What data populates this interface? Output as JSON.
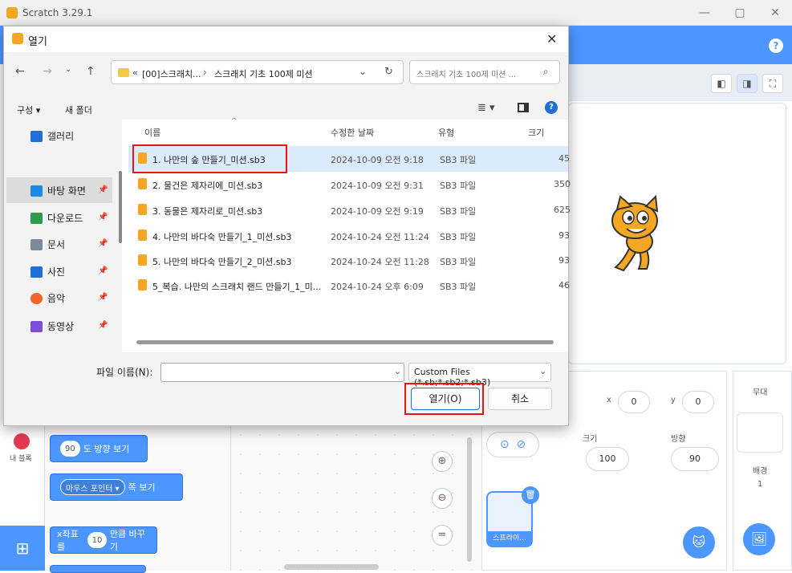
{
  "window": {
    "title": "Scratch 3.29.1",
    "minimize": "—",
    "maximize": "▢",
    "close": "✕"
  },
  "scratch": {
    "help": "?",
    "sprite_info": {
      "x_label": "x",
      "x_value": "0",
      "y_label": "y",
      "y_value": "0",
      "size_label": "크기",
      "size_value": "100",
      "direction_label": "방향",
      "direction_value": "90"
    },
    "sprite_thumb_label": "스프라이...",
    "stage_label": "무대",
    "backdrop_label": "배경",
    "backdrop_count": "1",
    "category": {
      "label": "내 블록"
    },
    "blocks": {
      "point_dir_value": "90",
      "point_dir_text": "도 방향 보기",
      "point_towards_value": "마우스 포인터 ▾",
      "point_towards_text": "쪽 보기",
      "change_x_prefix": "x좌표를",
      "change_x_value": "10",
      "change_x_suffix": "만큼 바꾸기"
    }
  },
  "dialog": {
    "title": "열기",
    "close": "✕",
    "address_parts": [
      "«",
      "[00]스크래치...",
      "›",
      "스크래치 기초 100제 미션"
    ],
    "search_placeholder": "스크래치 기초 100제 미션 ...",
    "commands": {
      "organize": "구성 ▾",
      "new_folder": "새 폴더"
    },
    "nav_items": [
      {
        "label": "갤러리",
        "color": "#1f6fd6"
      },
      {
        "label": "바탕 화면",
        "color": "#1e88e5",
        "pinned": true,
        "selected": true
      },
      {
        "label": "다운로드",
        "color": "#2e9a4a",
        "pinned": true
      },
      {
        "label": "문서",
        "color": "#7d8a99",
        "pinned": true
      },
      {
        "label": "사진",
        "color": "#1f6fd6",
        "pinned": true
      },
      {
        "label": "음악",
        "color": "#f06529",
        "pinned": true
      },
      {
        "label": "동영상",
        "color": "#7b4fd6",
        "pinned": true
      }
    ],
    "pin_glyph": "📌",
    "columns": {
      "name": "이름",
      "modified": "수정한 날짜",
      "type": "유형",
      "size": "크기"
    },
    "files": [
      {
        "name": "1. 나만의 숲 만들기_미션.sb3",
        "modified": "2024-10-09 오전 9:18",
        "type": "SB3 파일",
        "size": "45"
      },
      {
        "name": "2. 물건은 제자리에_미션.sb3",
        "modified": "2024-10-09 오전 9:31",
        "type": "SB3 파일",
        "size": "350"
      },
      {
        "name": "3. 동물은 제자리로_미션.sb3",
        "modified": "2024-10-09 오전 9:19",
        "type": "SB3 파일",
        "size": "625"
      },
      {
        "name": "4. 나만의 바다숙 만들기_1_미션.sb3",
        "modified": "2024-10-24 오전 11:24",
        "type": "SB3 파일",
        "size": "93"
      },
      {
        "name": "5. 나만의 바다숙 만들기_2_미션.sb3",
        "modified": "2024-10-24 오전 11:28",
        "type": "SB3 파일",
        "size": "93"
      },
      {
        "name": "5_복습. 나만의 스크래치 랜드 만들기_1_미...",
        "modified": "2024-10-24 오후 6:09",
        "type": "SB3 파일",
        "size": "46"
      }
    ],
    "filename_label": "파일 이름(N):",
    "filename_value": "",
    "filter_value": "Custom Files (*.sb;*.sb2;*.sb3)",
    "open_button": "열기(O)",
    "cancel_button": "취소"
  },
  "colors": {
    "scratch_blue": "#4c97ff",
    "highlight": "#e11111",
    "file_icon": "#f5a623"
  }
}
